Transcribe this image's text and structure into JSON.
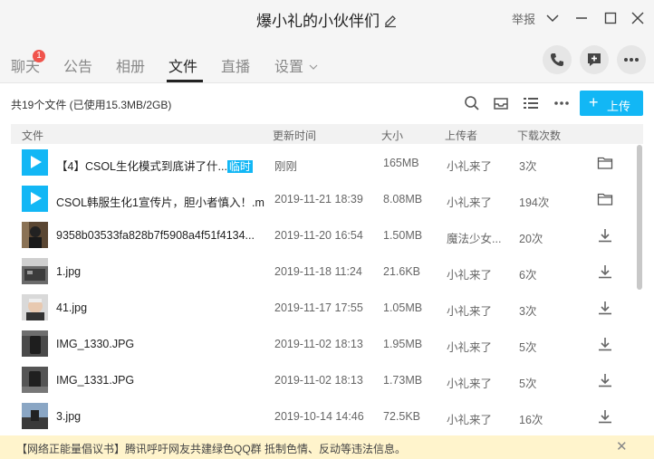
{
  "window": {
    "title": "爆小礼的小伙伴们",
    "report": "举报"
  },
  "tabs": [
    {
      "label": "聊天",
      "badge": "1"
    },
    {
      "label": "公告"
    },
    {
      "label": "相册"
    },
    {
      "label": "文件"
    },
    {
      "label": "直播"
    },
    {
      "label": "设置"
    }
  ],
  "toolbar": {
    "summary": "共19个文件 (已使用15.3MB/2GB)",
    "upload_label": "上传"
  },
  "table": {
    "headers": [
      "文件",
      "更新时间",
      "大小",
      "上传者",
      "下载次数"
    ],
    "rows": [
      {
        "name": "【4】CSOL生化模式到底讲了什...",
        "tag": "临时",
        "time": "刚刚",
        "size": "165MB",
        "uploader": "小礼来了",
        "downloads": "3次",
        "thumb": "video",
        "action": "folder-icon"
      },
      {
        "name": "CSOL韩服生化1宣传片，胆小者慎入！.m...",
        "tag": "",
        "time": "2019-11-21 18:39",
        "size": "8.08MB",
        "uploader": "小礼来了",
        "downloads": "194次",
        "thumb": "video",
        "action": "folder-icon"
      },
      {
        "name": "9358b03533fa828b7f5908a4f51f4134...",
        "tag": "",
        "time": "2019-11-20 16:54",
        "size": "1.50MB",
        "uploader": "魔法少女...",
        "downloads": "20次",
        "thumb": "image",
        "action": "download-icon"
      },
      {
        "name": "1.jpg",
        "tag": "",
        "time": "2019-11-18 11:24",
        "size": "21.6KB",
        "uploader": "小礼来了",
        "downloads": "6次",
        "thumb": "image",
        "action": "download-icon"
      },
      {
        "name": "41.jpg",
        "tag": "",
        "time": "2019-11-17 17:55",
        "size": "1.05MB",
        "uploader": "小礼来了",
        "downloads": "3次",
        "thumb": "image",
        "action": "download-icon"
      },
      {
        "name": "IMG_1330.JPG",
        "tag": "",
        "time": "2019-11-02 18:13",
        "size": "1.95MB",
        "uploader": "小礼来了",
        "downloads": "5次",
        "thumb": "image",
        "action": "download-icon"
      },
      {
        "name": "IMG_1331.JPG",
        "tag": "",
        "time": "2019-11-02 18:13",
        "size": "1.73MB",
        "uploader": "小礼来了",
        "downloads": "5次",
        "thumb": "image",
        "action": "download-icon"
      },
      {
        "name": "3.jpg",
        "tag": "",
        "time": "2019-10-14 14:46",
        "size": "72.5KB",
        "uploader": "小礼来了",
        "downloads": "16次",
        "thumb": "image",
        "action": "download-icon"
      }
    ]
  },
  "notice": {
    "text": "【网络正能量倡议书】腾讯呼吁网友共建绿色QQ群 抵制色情、反动等违法信息。"
  },
  "colors": {
    "accent": "#12b7f5",
    "badge": "#f0544c",
    "notice_bg": "#fff4cc"
  }
}
